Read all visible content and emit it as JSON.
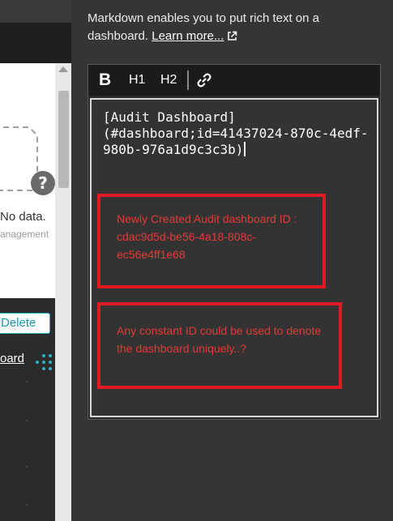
{
  "info": {
    "description": "Markdown enables you to put rich text on a dashboard.",
    "learn_more_label": "Learn more..."
  },
  "toolbar": {
    "bold_label": "B",
    "h1_label": "H1",
    "h2_label": "H2"
  },
  "editor": {
    "content": "[Audit Dashboard]\n(#dashboard;id=41437024-870c-4edf-980b-976a1d9c3c3b)"
  },
  "annotations": [
    {
      "text": "Newly Created  Audit dashboard ID :  cdac9d5d-be56-4a18-808c-ec56e4ff1e68"
    },
    {
      "text": "Any constant ID could be used to denote the dashboard uniquely..?"
    }
  ],
  "left_panel": {
    "help_label": "?",
    "no_data_label": "No data.",
    "management_label": "anagement",
    "delete_label": "Delete",
    "dashboard_link_label": "oard"
  },
  "colors": {
    "accent": "#1fb2c8",
    "annotation": "#e01b24",
    "panel_bg": "#353535"
  }
}
